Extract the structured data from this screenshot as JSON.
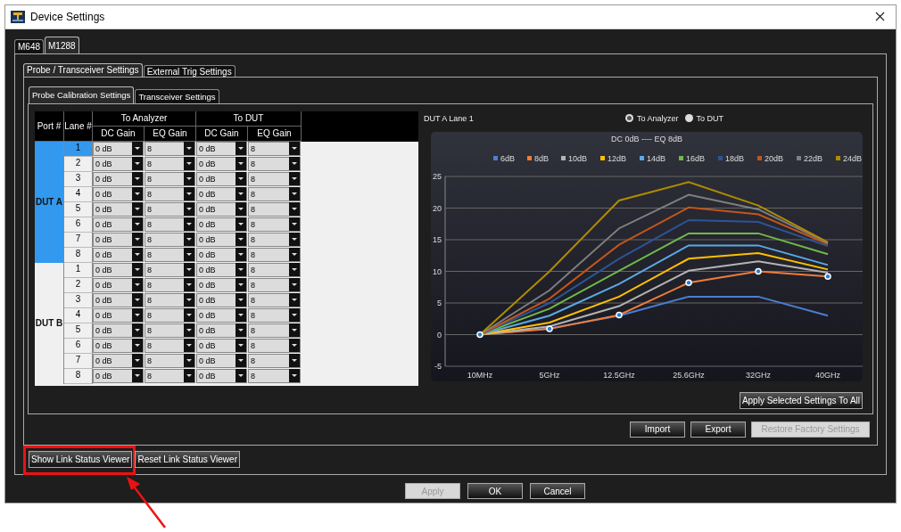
{
  "window": {
    "title": "Device Settings"
  },
  "device_tabs": [
    {
      "label": "M648",
      "selected": false
    },
    {
      "label": "M1288",
      "selected": true
    }
  ],
  "settings_tabs": [
    {
      "label": "Probe / Transceiver Settings",
      "selected": true
    },
    {
      "label": "External Trig Settings",
      "selected": false
    }
  ],
  "calibration_tabs": [
    {
      "label": "Probe Calibration Settings",
      "selected": true
    },
    {
      "label": "Transceiver Settings",
      "selected": false
    }
  ],
  "table": {
    "port_header": "Port #",
    "lane_header": "Lane #",
    "groups": [
      {
        "label": "To Analyzer",
        "columns": [
          "DC Gain",
          "EQ Gain"
        ]
      },
      {
        "label": "To DUT",
        "columns": [
          "DC Gain",
          "EQ Gain"
        ]
      }
    ],
    "ports": [
      {
        "name": "DUT A",
        "selected": true,
        "lanes": [
          {
            "lane": "1",
            "selected": true,
            "values": [
              "0 dB",
              "8",
              "0 dB",
              "8"
            ]
          },
          {
            "lane": "2",
            "selected": false,
            "values": [
              "0 dB",
              "8",
              "0 dB",
              "8"
            ]
          },
          {
            "lane": "3",
            "selected": false,
            "values": [
              "0 dB",
              "8",
              "0 dB",
              "8"
            ]
          },
          {
            "lane": "4",
            "selected": false,
            "values": [
              "0 dB",
              "8",
              "0 dB",
              "8"
            ]
          },
          {
            "lane": "5",
            "selected": false,
            "values": [
              "0 dB",
              "8",
              "0 dB",
              "8"
            ]
          },
          {
            "lane": "6",
            "selected": false,
            "values": [
              "0 dB",
              "8",
              "0 dB",
              "8"
            ]
          },
          {
            "lane": "7",
            "selected": false,
            "values": [
              "0 dB",
              "8",
              "0 dB",
              "8"
            ]
          },
          {
            "lane": "8",
            "selected": false,
            "values": [
              "0 dB",
              "8",
              "0 dB",
              "8"
            ]
          }
        ]
      },
      {
        "name": "DUT B",
        "selected": false,
        "lanes": [
          {
            "lane": "1",
            "selected": false,
            "values": [
              "0 dB",
              "8",
              "0 dB",
              "8"
            ]
          },
          {
            "lane": "2",
            "selected": false,
            "values": [
              "0 dB",
              "8",
              "0 dB",
              "8"
            ]
          },
          {
            "lane": "3",
            "selected": false,
            "values": [
              "0 dB",
              "8",
              "0 dB",
              "8"
            ]
          },
          {
            "lane": "4",
            "selected": false,
            "values": [
              "0 dB",
              "8",
              "0 dB",
              "8"
            ]
          },
          {
            "lane": "5",
            "selected": false,
            "values": [
              "0 dB",
              "8",
              "0 dB",
              "8"
            ]
          },
          {
            "lane": "6",
            "selected": false,
            "values": [
              "0 dB",
              "8",
              "0 dB",
              "8"
            ]
          },
          {
            "lane": "7",
            "selected": false,
            "values": [
              "0 dB",
              "8",
              "0 dB",
              "8"
            ]
          },
          {
            "lane": "8",
            "selected": false,
            "values": [
              "0 dB",
              "8",
              "0 dB",
              "8"
            ]
          }
        ]
      }
    ]
  },
  "chart_panel": {
    "caption": "DUT A Lane 1",
    "targets": [
      {
        "label": "To Analyzer",
        "selected": true
      },
      {
        "label": "To DUT",
        "selected": false
      }
    ],
    "chart_data": {
      "type": "line",
      "title": "DC 0dB ---- EQ 8dB",
      "categories": [
        "10MHz",
        "5GHz",
        "12.5GHz",
        "25.6GHz",
        "32GHz",
        "40GHz"
      ],
      "ylim": [
        -5,
        25
      ],
      "yticks": [
        -5,
        0,
        5,
        10,
        15,
        20,
        25
      ],
      "grid": true,
      "legend": true,
      "series": [
        {
          "name": "6dB",
          "color": "#4a7fd4",
          "values": [
            0,
            1,
            3,
            6,
            6,
            3
          ]
        },
        {
          "name": "8dB",
          "color": "#f07c3a",
          "marker": "circle",
          "values": [
            0,
            0.9,
            3.1,
            8.2,
            10,
            9.2
          ]
        },
        {
          "name": "10dB",
          "color": "#b4b4b4",
          "values": [
            0,
            1.3,
            4.5,
            10.1,
            11.6,
            9.8
          ]
        },
        {
          "name": "12dB",
          "color": "#ffc000",
          "values": [
            0,
            1.9,
            6,
            12,
            12.9,
            10.3
          ]
        },
        {
          "name": "14dB",
          "color": "#5aaae8",
          "values": [
            0,
            3,
            8,
            14.1,
            14.1,
            11
          ]
        },
        {
          "name": "16dB",
          "color": "#70b94a",
          "values": [
            0,
            4.1,
            10.1,
            16,
            16,
            12.7
          ]
        },
        {
          "name": "18dB",
          "color": "#2d5496",
          "values": [
            0,
            5,
            12,
            18.1,
            17.8,
            14
          ]
        },
        {
          "name": "20dB",
          "color": "#c0561c",
          "values": [
            0,
            5.7,
            14.2,
            20.1,
            19,
            14.3
          ]
        },
        {
          "name": "22dB",
          "color": "#7f7f7f",
          "values": [
            0,
            7,
            16.8,
            22.1,
            19.8,
            14.5
          ]
        },
        {
          "name": "24dB",
          "color": "#b08c00",
          "values": [
            0,
            10,
            21.2,
            24.1,
            20.4,
            14.6
          ]
        }
      ]
    }
  },
  "apply_all_button": {
    "label": "Apply Selected Settings To All"
  },
  "actions": [
    {
      "label": "Import",
      "disabled": false
    },
    {
      "label": "Export",
      "disabled": false
    },
    {
      "label": "Restore Factory Settings",
      "disabled": true
    }
  ],
  "link_buttons": [
    {
      "label": "Show Link Status Viewer",
      "highlighted": true
    },
    {
      "label": "Reset Link Status Viewer",
      "highlighted": false
    }
  ],
  "dialog_buttons": [
    {
      "label": "Apply",
      "disabled": true
    },
    {
      "label": "OK",
      "disabled": false
    },
    {
      "label": "Cancel",
      "disabled": false
    }
  ]
}
